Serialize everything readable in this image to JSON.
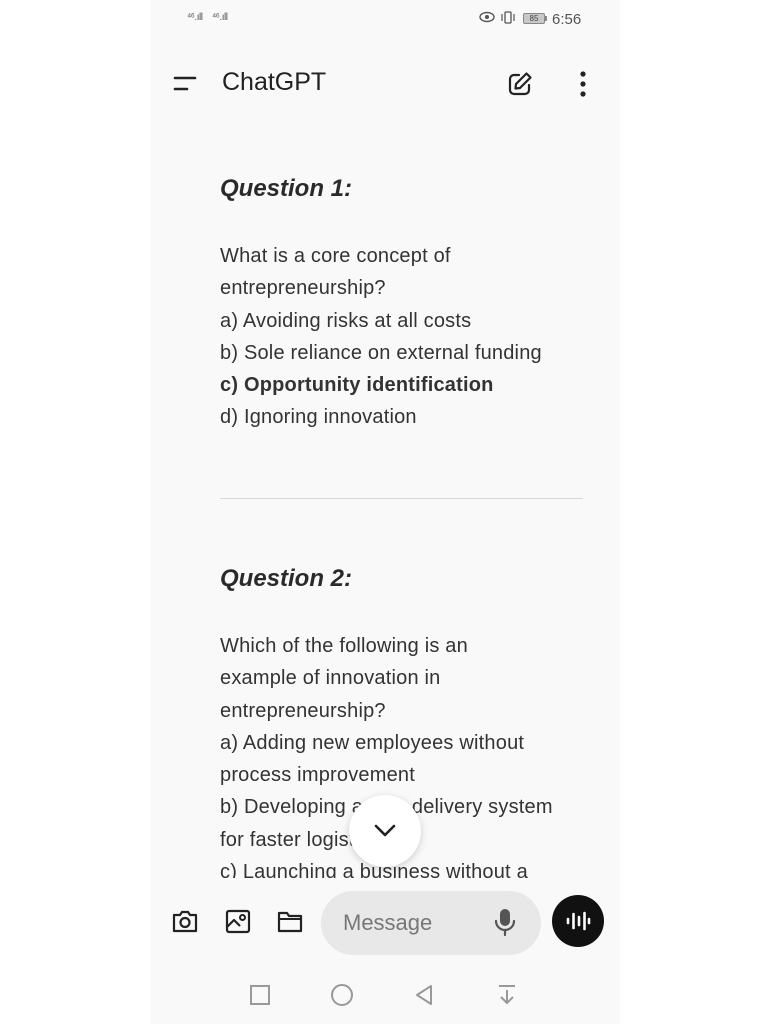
{
  "status_bar": {
    "signal_1": "⁴⁶.ıll",
    "signal_2": "⁴⁶.ıll",
    "battery": "85",
    "time": "6:56"
  },
  "app_bar": {
    "title": "ChatGPT"
  },
  "chat": {
    "q1_heading": "Question 1:",
    "q1_text_1": "What is a core concept of",
    "q1_text_2": "entrepreneurship?",
    "q1_option_a": "a) Avoiding risks at all costs",
    "q1_option_b": "b) Sole reliance on external funding",
    "q1_option_c": "c) Opportunity identification",
    "q1_option_d": "d) Ignoring innovation",
    "q2_heading": "Question 2:",
    "q2_text_1": "Which of the following is an",
    "q2_text_2": "example of innovation in",
    "q2_text_3": "entrepreneurship?",
    "q2_option_a_1": "a) Adding new employees without",
    "q2_option_a_2": "process improvement",
    "q2_option_b_1": "b) Developing a new delivery system",
    "q2_option_b_2": "for faster logistics",
    "q2_option_c_1": "c) Launching a business without a"
  },
  "input_bar": {
    "placeholder": "Message"
  },
  "icons": [
    "menu-icon",
    "edit-icon",
    "more-icon",
    "chevron-down-icon",
    "camera-icon",
    "image-icon",
    "folder-icon",
    "microphone-icon",
    "voice-icon",
    "recents-icon",
    "home-icon",
    "back-icon",
    "notification-pull-icon"
  ]
}
